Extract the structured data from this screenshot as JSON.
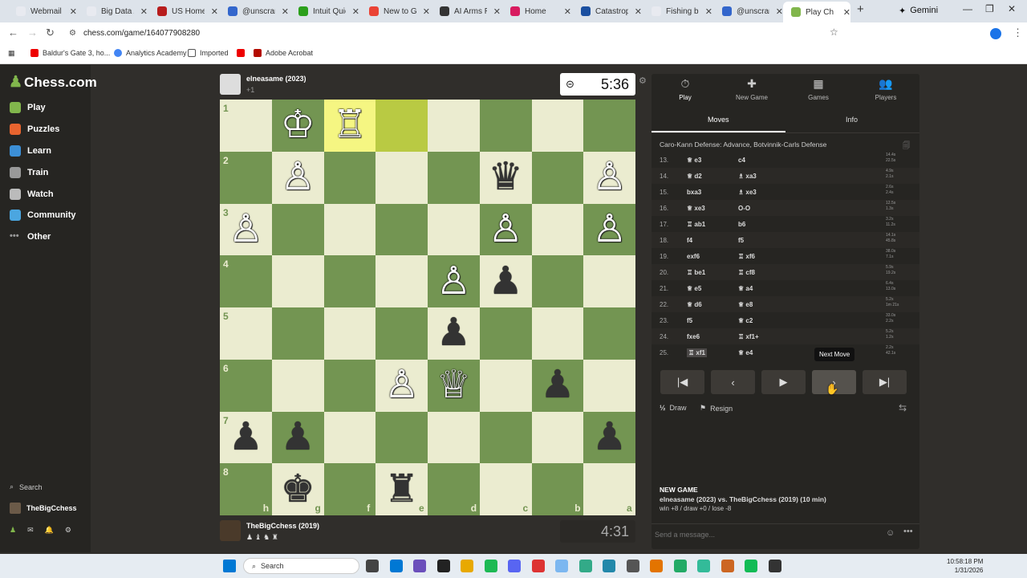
{
  "browser": {
    "tabs": [
      {
        "label": "Webmail",
        "color": "#e8eaf0"
      },
      {
        "label": "Big Data A",
        "color": "#e8eaf0"
      },
      {
        "label": "US Home",
        "color": "#b71c1c"
      },
      {
        "label": "@unscram",
        "color": "#3366cc"
      },
      {
        "label": "Intuit Quick",
        "color": "#2ca01c"
      },
      {
        "label": "New to Go",
        "color": "#ea4335"
      },
      {
        "label": "AI Arms Ra",
        "color": "#333333"
      },
      {
        "label": "Home",
        "color": "#d81b60"
      },
      {
        "label": "Catastroph",
        "color": "#1a4fa0"
      },
      {
        "label": "Fishing bo",
        "color": "#e8eaf0"
      },
      {
        "label": "@unscram",
        "color": "#3366cc"
      },
      {
        "label": "Play Ch",
        "color": "#81b64c"
      }
    ],
    "gemini_label": "Gemini",
    "url": "chess.com/game/164077908280",
    "bookmarks": [
      "Baldur's Gate 3, ho...",
      "Analytics Academy",
      "Imported",
      "",
      "Adobe Acrobat"
    ]
  },
  "sidebar": {
    "logo": "Chess.com",
    "items": [
      {
        "label": "Play",
        "color": "#81b64c"
      },
      {
        "label": "Puzzles",
        "color": "#e8642f"
      },
      {
        "label": "Learn",
        "color": "#3c8fd6"
      },
      {
        "label": "Train",
        "color": "#999999"
      },
      {
        "label": "Watch",
        "color": "#bbbbbb"
      },
      {
        "label": "Community",
        "color": "#4ba6e0"
      },
      {
        "label": "Other",
        "color": "#999999"
      }
    ],
    "search": "Search",
    "user": "TheBigCchess"
  },
  "top_player": {
    "name": "elneasame (2023)",
    "material": "+1",
    "clock": "5:36"
  },
  "bottom_player": {
    "name": "TheBigCchess (2019)",
    "clock": "4:31"
  },
  "board": {
    "ranks": [
      "1",
      "2",
      "3",
      "4",
      "5",
      "6",
      "7",
      "8"
    ],
    "files": [
      "h",
      "g",
      "f",
      "e",
      "d",
      "c",
      "b",
      "a"
    ],
    "highlight": [
      [
        0,
        2
      ],
      [
        0,
        3
      ]
    ],
    "pieces": [
      {
        "r": 0,
        "c": 1,
        "p": "♔",
        "color": "w"
      },
      {
        "r": 0,
        "c": 2,
        "p": "♖",
        "color": "w"
      },
      {
        "r": 1,
        "c": 1,
        "p": "♙",
        "color": "w"
      },
      {
        "r": 1,
        "c": 5,
        "p": "♛",
        "color": "b"
      },
      {
        "r": 1,
        "c": 7,
        "p": "♙",
        "color": "w"
      },
      {
        "r": 2,
        "c": 0,
        "p": "♙",
        "color": "w"
      },
      {
        "r": 2,
        "c": 5,
        "p": "♙",
        "color": "w"
      },
      {
        "r": 2,
        "c": 7,
        "p": "♙",
        "color": "w"
      },
      {
        "r": 3,
        "c": 4,
        "p": "♙",
        "color": "w"
      },
      {
        "r": 3,
        "c": 5,
        "p": "♟",
        "color": "b"
      },
      {
        "r": 4,
        "c": 4,
        "p": "♟",
        "color": "b"
      },
      {
        "r": 5,
        "c": 3,
        "p": "♙",
        "color": "w"
      },
      {
        "r": 5,
        "c": 4,
        "p": "♕",
        "color": "w"
      },
      {
        "r": 5,
        "c": 6,
        "p": "♟",
        "color": "b"
      },
      {
        "r": 6,
        "c": 0,
        "p": "♟",
        "color": "b"
      },
      {
        "r": 6,
        "c": 1,
        "p": "♟",
        "color": "b"
      },
      {
        "r": 6,
        "c": 7,
        "p": "♟",
        "color": "b"
      },
      {
        "r": 7,
        "c": 1,
        "p": "♚",
        "color": "b"
      },
      {
        "r": 7,
        "c": 3,
        "p": "♜",
        "color": "b"
      }
    ]
  },
  "panel": {
    "tabs": [
      {
        "label": "Play",
        "icon": "⏱"
      },
      {
        "label": "New Game",
        "icon": "✚"
      },
      {
        "label": "Games",
        "icon": "▦"
      },
      {
        "label": "Players",
        "icon": "👥"
      }
    ],
    "subtabs": [
      "Moves",
      "Info"
    ],
    "opening": "Caro-Kann Defense: Advance, Botvinnik-Carls Defense",
    "moves": [
      {
        "n": "13.",
        "w": "♕ e3",
        "b": "c4",
        "tw": "14.4s",
        "tb": "22.5s"
      },
      {
        "n": "14.",
        "w": "♕ d2",
        "b": "♗ xa3",
        "tw": "4.9s",
        "tb": "2.1s"
      },
      {
        "n": "15.",
        "w": "bxa3",
        "b": "♗ xe3",
        "tw": "2.6s",
        "tb": "2.4s"
      },
      {
        "n": "16.",
        "w": "♕ xe3",
        "b": "O-O",
        "tw": "12.5s",
        "tb": "1.3s"
      },
      {
        "n": "17.",
        "w": "♖ ab1",
        "b": "b6",
        "tw": "3.2s",
        "tb": "11.2s"
      },
      {
        "n": "18.",
        "w": "f4",
        "b": "f5",
        "tw": "14.1s",
        "tb": "45.8s"
      },
      {
        "n": "19.",
        "w": "exf6",
        "b": "♖ xf6",
        "tw": "38.0s",
        "tb": "7.1s"
      },
      {
        "n": "20.",
        "w": "♖ be1",
        "b": "♖ cf8",
        "tw": "5.9s",
        "tb": "19.2s"
      },
      {
        "n": "21.",
        "w": "♕ e5",
        "b": "♕ a4",
        "tw": "6.4s",
        "tb": "13.0s"
      },
      {
        "n": "22.",
        "w": "♕ d6",
        "b": "♕ e8",
        "tw": "5.2s",
        "tb": "1m 21s"
      },
      {
        "n": "23.",
        "w": "f5",
        "b": "♕ c2",
        "tw": "33.0s",
        "tb": "2.2s"
      },
      {
        "n": "24.",
        "w": "fxe6",
        "b": "♖ xf1+",
        "tw": "5.2s",
        "tb": "1.2s"
      },
      {
        "n": "25.",
        "w": "♖ xf1",
        "b": "♕ e4",
        "tw": "2.2s",
        "tb": "42.1s"
      }
    ],
    "tooltip": "Next Move",
    "draw": "Draw",
    "resign": "Resign",
    "new_game_title": "NEW GAME",
    "new_game_line": "elneasame (2023) vs. TheBigCchess (2019) (10 min)",
    "new_game_record": "win +8 / draw +0 / lose -8",
    "message_placeholder": "Send a message..."
  },
  "taskbar": {
    "search": "Search",
    "time": "10:58:18 PM",
    "date": "1/31/2026"
  }
}
